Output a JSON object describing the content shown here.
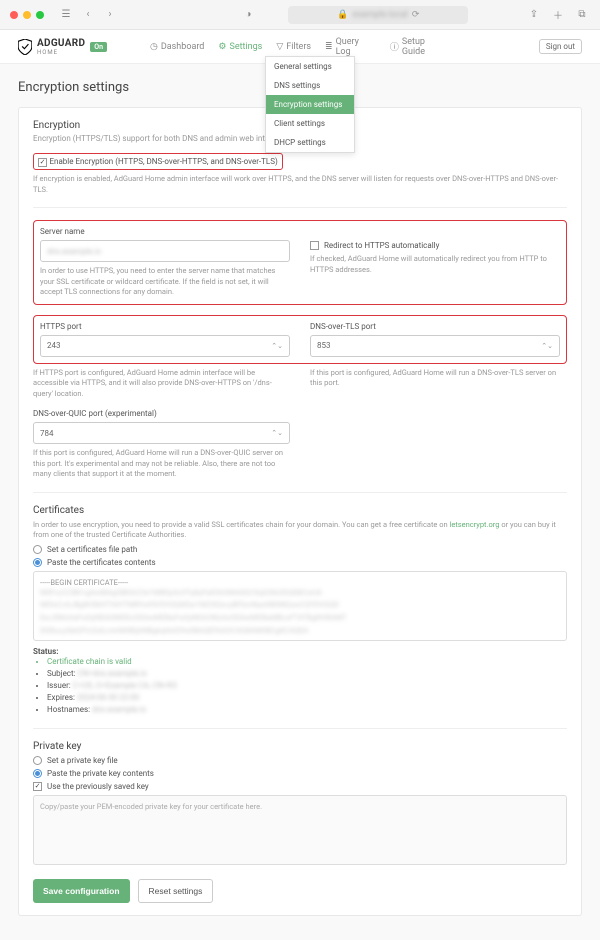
{
  "browser": {
    "url_host": "example.local",
    "reload_icon": "⟳",
    "lock_icon": "🔒"
  },
  "header": {
    "brand": "ADGUARD",
    "brand_sub": "HOME",
    "badge": "On",
    "nav": {
      "dashboard": "Dashboard",
      "settings": "Settings",
      "filters": "Filters",
      "querylog": "Query Log",
      "setup": "Setup Guide"
    },
    "signout": "Sign out"
  },
  "dropdown": {
    "items": [
      "General settings",
      "DNS settings",
      "Encryption settings",
      "Client settings",
      "DHCP settings"
    ],
    "selected_index": 2
  },
  "page": {
    "title": "Encryption settings",
    "enc": {
      "heading": "Encryption",
      "desc": "Encryption (HTTPS/TLS) support for both DNS and admin web interface",
      "enable_label": "Enable Encryption (HTTPS, DNS-over-HTTPS, and DNS-over-TLS)",
      "enable_help": "If encryption is enabled, AdGuard Home admin interface will work over HTTPS, and the DNS server will listen for requests over DNS-over-HTTPS and DNS-over-TLS."
    },
    "server": {
      "label": "Server name",
      "value": "dns.example.io",
      "help": "In order to use HTTPS, you need to enter the server name that matches your SSL certificate or wildcard certificate. If the field is not set, it will accept TLS connections for any domain.",
      "redirect_label": "Redirect to HTTPS automatically",
      "redirect_help": "If checked, AdGuard Home will automatically redirect you from HTTP to HTTPS addresses."
    },
    "ports": {
      "https_label": "HTTPS port",
      "https_value": "243",
      "https_help": "If HTTPS port is configured, AdGuard Home admin interface will be accessible via HTTPS, and it will also provide DNS-over-HTTPS on '/dns-query' location.",
      "dot_label": "DNS-over-TLS port",
      "dot_value": "853",
      "dot_help": "If this port is configured, AdGuard Home will run a DNS-over-TLS server on this port."
    },
    "doq": {
      "label": "DNS-over-QUIC port (experimental)",
      "value": "784",
      "help": "If this port is configured, AdGuard Home will run a DNS-over-QUIC server on this port. It's experimental and may not be reliable. Also, there are not too many clients that support it at the moment."
    },
    "certs": {
      "heading": "Certificates",
      "desc_a": "In order to use encryption, you need to provide a valid SSL certificates chain for your domain. You can get a free certificate on ",
      "desc_link": "letsencrypt.org",
      "desc_b": " or you can buy it from one of the trusted Certificate Authorities.",
      "opt_file": "Set a certificates file path",
      "opt_paste": "Paste the certificates contents",
      "begin": "-----BEGIN CERTIFICATE-----",
      "status_label": "Status:",
      "chain_valid": "Certificate chain is valid",
      "subject_label": "Subject: ",
      "issuer_label": "Issuer: ",
      "expires_label": "Expires: ",
      "hosts_label": "Hostnames: ",
      "subject_val": "CN=dns.example.io",
      "issuer_val": "C=US, O=Example CA, CN=R3",
      "expires_val": "2024-06-30 22:00",
      "hosts_val": "dns.example.io"
    },
    "pkey": {
      "heading": "Private key",
      "opt_file": "Set a private key file",
      "opt_paste": "Paste the private key contents",
      "use_saved": "Use the previously saved key",
      "placeholder": "Copy/paste your PEM-encoded private key for your certificate here."
    },
    "buttons": {
      "save": "Save configuration",
      "reset": "Reset settings"
    }
  }
}
